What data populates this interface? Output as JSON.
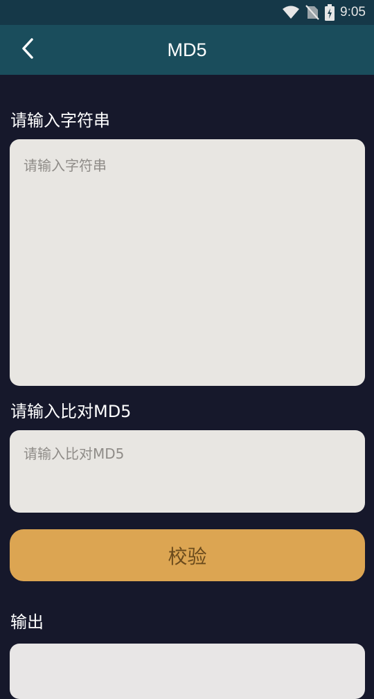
{
  "status_bar": {
    "time": "9:05",
    "icons": [
      "wifi-icon",
      "no-sim-icon",
      "battery-charging-icon"
    ]
  },
  "app_bar": {
    "title": "MD5",
    "back_icon": "chevron-left-icon"
  },
  "input_section": {
    "label": "请输入字符串",
    "placeholder": "请输入字符串",
    "value": ""
  },
  "compare_section": {
    "label": "请输入比对MD5",
    "placeholder": "请输入比对MD5",
    "value": ""
  },
  "verify_button": {
    "label": "校验"
  },
  "output_section": {
    "label": "输出",
    "value": ""
  },
  "colors": {
    "background": "#16182b",
    "app_bar": "#1a4d5c",
    "status_bar": "#153848",
    "input_bg": "#e8e6e2",
    "button": "#dca552"
  }
}
